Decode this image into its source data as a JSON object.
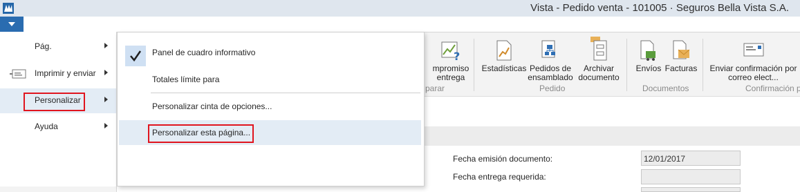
{
  "window": {
    "title": "Vista - Pedido venta - 101005 · Seguros Bella Vista S.A."
  },
  "file_menu": {
    "items": [
      {
        "label": "Pág."
      },
      {
        "label": "Imprimir y enviar"
      },
      {
        "label": "Personalizar"
      },
      {
        "label": "Ayuda"
      }
    ]
  },
  "submenu": {
    "items": [
      {
        "label": "Panel de cuadro informativo",
        "checked": true
      },
      {
        "label": "Totales límite para"
      },
      {
        "label": "Personalizar cinta de opciones..."
      },
      {
        "label": "Personalizar esta página..."
      }
    ]
  },
  "ribbon": {
    "buttons": [
      {
        "label1": "mpromiso",
        "label2": "entrega",
        "icon": "chart-question-icon"
      },
      {
        "label1": "Estadísticas",
        "label2": "",
        "icon": "statistics-icon"
      },
      {
        "label1": "Pedidos de",
        "label2": "ensamblado",
        "icon": "assembly-orders-icon"
      },
      {
        "label1": "Archivar",
        "label2": "documento",
        "icon": "archive-icon"
      },
      {
        "label1": "Envíos",
        "label2": "",
        "icon": "shipments-icon"
      },
      {
        "label1": "Facturas",
        "label2": "",
        "icon": "invoices-icon"
      },
      {
        "label1": "Enviar confirmación por",
        "label2": "correo elect...",
        "icon": "email-confirmation-icon"
      }
    ],
    "groups": [
      {
        "label": "parar"
      },
      {
        "label": "Pedido"
      },
      {
        "label": "Documentos"
      },
      {
        "label": "Confirmación p"
      }
    ]
  },
  "form": {
    "fields": [
      {
        "label": "Fecha emisión documento:",
        "value": "12/01/2017"
      },
      {
        "label": "Fecha entrega requerida:",
        "value": ""
      }
    ]
  },
  "colors": {
    "accent": "#2a6cb0",
    "highlight": "#e0141e",
    "hover": "#e3ecf5"
  }
}
